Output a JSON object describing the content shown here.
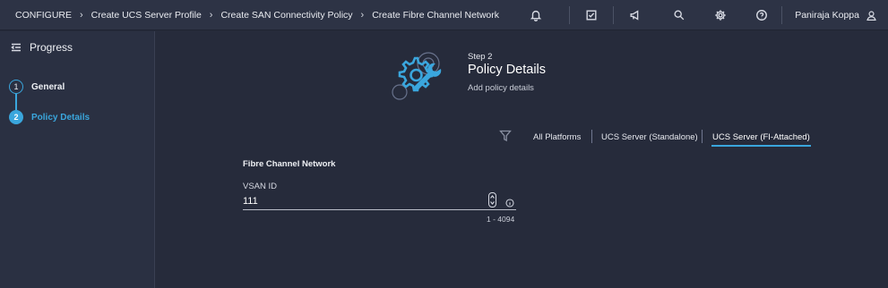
{
  "breadcrumbs": [
    "CONFIGURE",
    "Create UCS Server Profile",
    "Create SAN Connectivity Policy",
    "Create Fibre Channel Network"
  ],
  "top_icons": [
    "bell-icon",
    "checklist-icon",
    "megaphone-icon",
    "search-icon",
    "gear-icon",
    "help-icon"
  ],
  "user": {
    "name": "Paniraja Koppa",
    "icon": "user-icon"
  },
  "sidebar": {
    "title": "Progress",
    "steps": [
      {
        "number": "1",
        "label": "General",
        "state": "completed"
      },
      {
        "number": "2",
        "label": "Policy Details",
        "state": "active"
      }
    ]
  },
  "header": {
    "step_label": "Step 2",
    "title": "Policy Details",
    "subtitle": "Add policy details"
  },
  "filters": {
    "icon": "filter-icon",
    "tabs": [
      "All Platforms",
      "UCS Server (Standalone)",
      "UCS Server (FI-Attached)"
    ],
    "selected": "UCS Server (FI-Attached)"
  },
  "form": {
    "section_title": "Fibre Channel Network",
    "vsan_label": "VSAN ID",
    "vsan_value": "111",
    "vsan_range": "1 - 4094"
  },
  "colors": {
    "accent": "#3aa6dd",
    "background": "#262b3b",
    "topbar": "#2d3345",
    "sidebar": "#2a3042"
  }
}
